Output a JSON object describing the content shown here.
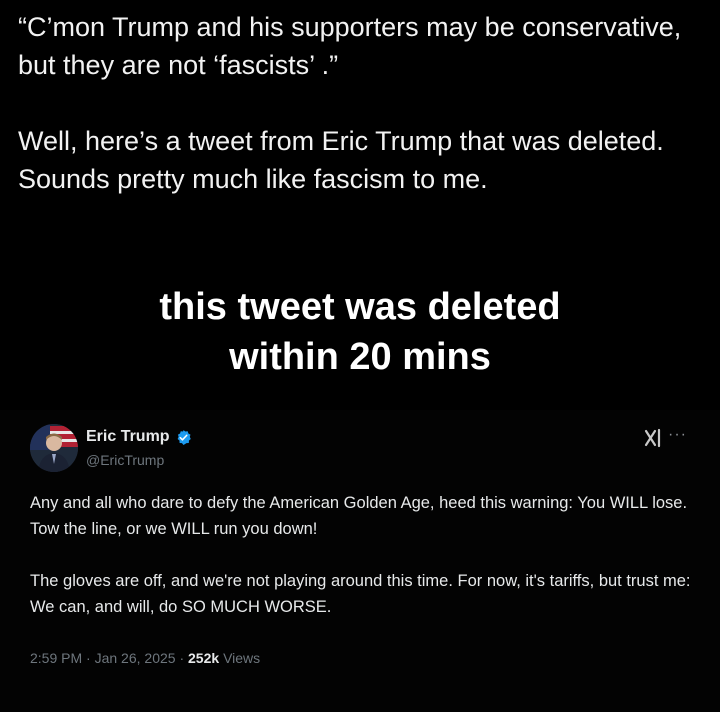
{
  "post": {
    "paragraph_1": "“C’mon Trump and his supporters may be conservative, but they are not ‘fascists’ .”",
    "paragraph_2": "Well, here’s a tweet from Eric Trump that was deleted.  Sounds pretty much like fascism to me."
  },
  "overlay": {
    "line_1": "this tweet was deleted",
    "line_2": "within 20 mins"
  },
  "tweet": {
    "author_name": "Eric Trump",
    "author_handle": "@EricTrump",
    "grok_icon": "xAI",
    "more_icon": "···",
    "body_paragraph_1": "Any and all who dare to defy the American Golden Age, heed this warning: You WILL lose. Tow the line, or we WILL run you down!",
    "body_paragraph_2": "The gloves are off, and we're not playing around this time. For now, it's tariffs, but trust me: We can, and will, do SO MUCH WORSE.",
    "time": "2:59 PM",
    "separator": "·",
    "date": "Jan 26, 2025",
    "views_count": "252k",
    "views_label": "Views",
    "verified_color": "#1d9bf0"
  }
}
